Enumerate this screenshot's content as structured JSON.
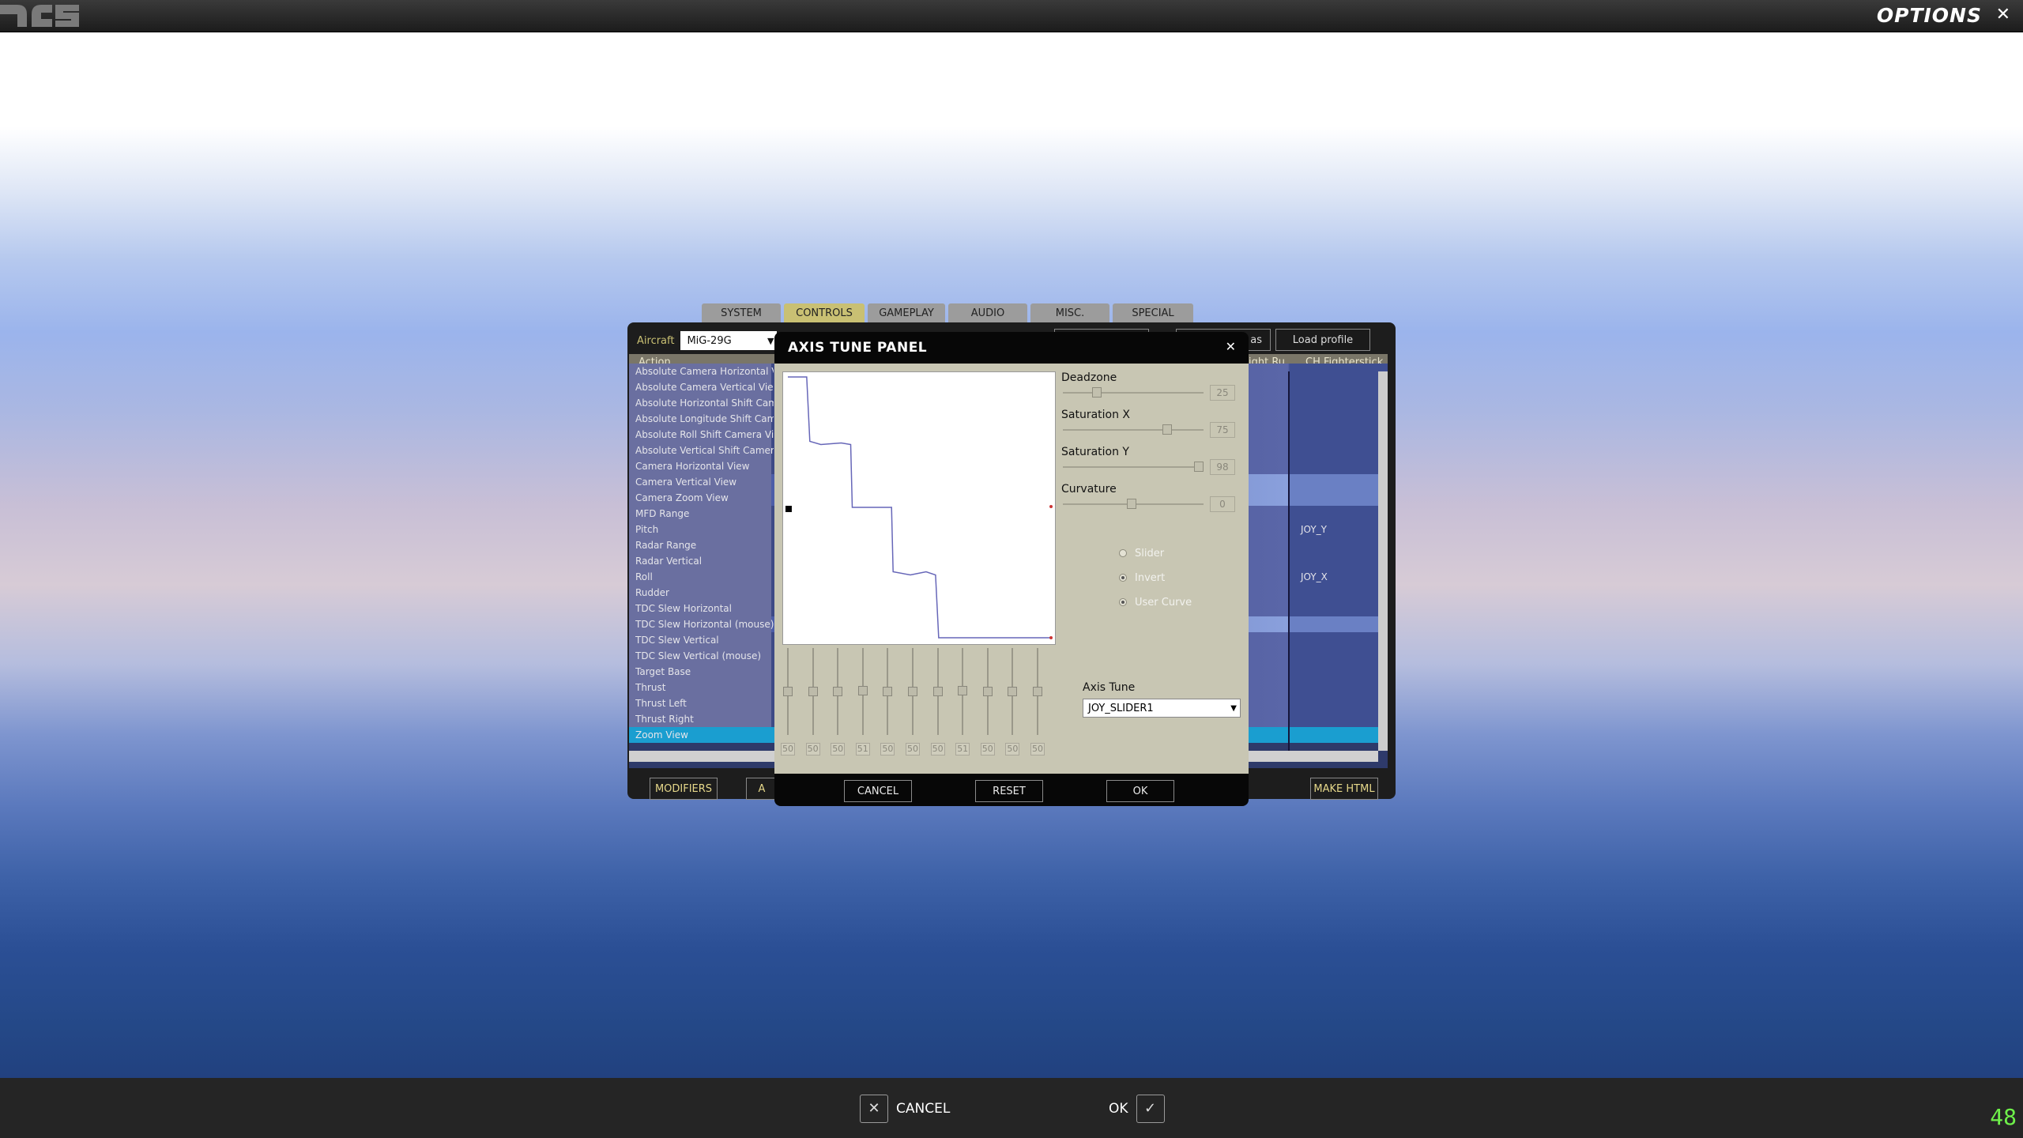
{
  "window": {
    "title": "OPTIONS",
    "close_icon": "close-icon",
    "fps": "48"
  },
  "tabs": [
    "SYSTEM",
    "CONTROLS",
    "GAMEPLAY",
    "AUDIO",
    "MISC.",
    "SPECIAL"
  ],
  "active_tab": "CONTROLS",
  "controls": {
    "aircraft_label": "Aircraft",
    "aircraft_value": "MiG-29G",
    "top_buttons": [
      "as",
      "Load profile"
    ],
    "columns": {
      "action": "Action",
      "col2": "ight Ru",
      "col3": "CH Fighterstick"
    },
    "rows": [
      {
        "label": "Absolute Camera Horizontal View",
        "bind": ""
      },
      {
        "label": "Absolute Camera Vertical View",
        "bind": ""
      },
      {
        "label": "Absolute Horizontal Shift Camera View",
        "bind": ""
      },
      {
        "label": "Absolute Longitude Shift Camera View",
        "bind": ""
      },
      {
        "label": "Absolute Roll Shift Camera View",
        "bind": ""
      },
      {
        "label": "Absolute Vertical Shift Camera View",
        "bind": ""
      },
      {
        "label": "Camera Horizontal View",
        "bind": ""
      },
      {
        "label": "Camera Vertical View",
        "bind": ""
      },
      {
        "label": "Camera Zoom View",
        "bind": ""
      },
      {
        "label": "MFD Range",
        "bind": ""
      },
      {
        "label": "Pitch",
        "bind": "JOY_Y"
      },
      {
        "label": "Radar Range",
        "bind": ""
      },
      {
        "label": "Radar Vertical",
        "bind": ""
      },
      {
        "label": "Roll",
        "bind": "JOY_X"
      },
      {
        "label": "Rudder",
        "bind": ""
      },
      {
        "label": "TDC Slew Horizontal",
        "bind": ""
      },
      {
        "label": "TDC Slew Horizontal (mouse)",
        "bind": ""
      },
      {
        "label": "TDC Slew Vertical",
        "bind": ""
      },
      {
        "label": "TDC Slew Vertical (mouse)",
        "bind": ""
      },
      {
        "label": "Target Base",
        "bind": ""
      },
      {
        "label": "Thrust",
        "bind": ""
      },
      {
        "label": "Thrust Left",
        "bind": ""
      },
      {
        "label": "Thrust Right",
        "bind": ""
      },
      {
        "label": "Zoom View",
        "bind": ""
      }
    ],
    "selected_row": "Zoom View",
    "bottom_buttons": {
      "modifiers": "MODIFIERS",
      "partial": "A",
      "make_html": "MAKE HTML"
    }
  },
  "axis_tune": {
    "title": "AXIS TUNE PANEL",
    "deadzone": {
      "label": "Deadzone",
      "value": "25"
    },
    "saturation_x": {
      "label": "Saturation X",
      "value": "75"
    },
    "saturation_y": {
      "label": "Saturation Y",
      "value": "98"
    },
    "curvature": {
      "label": "Curvature",
      "value": "0"
    },
    "options": [
      {
        "label": "Slider",
        "checked": false
      },
      {
        "label": "Invert",
        "checked": true
      },
      {
        "label": "User Curve",
        "checked": true
      }
    ],
    "axis_tune_label": "Axis Tune",
    "axis_value": "JOY_SLIDER1",
    "curve_points": [
      "50",
      "50",
      "50",
      "51",
      "50",
      "50",
      "50",
      "51",
      "50",
      "50",
      "50"
    ],
    "buttons": {
      "cancel": "CANCEL",
      "reset": "RESET",
      "ok": "OK"
    }
  },
  "footer": {
    "cancel": "CANCEL",
    "ok": "OK"
  }
}
